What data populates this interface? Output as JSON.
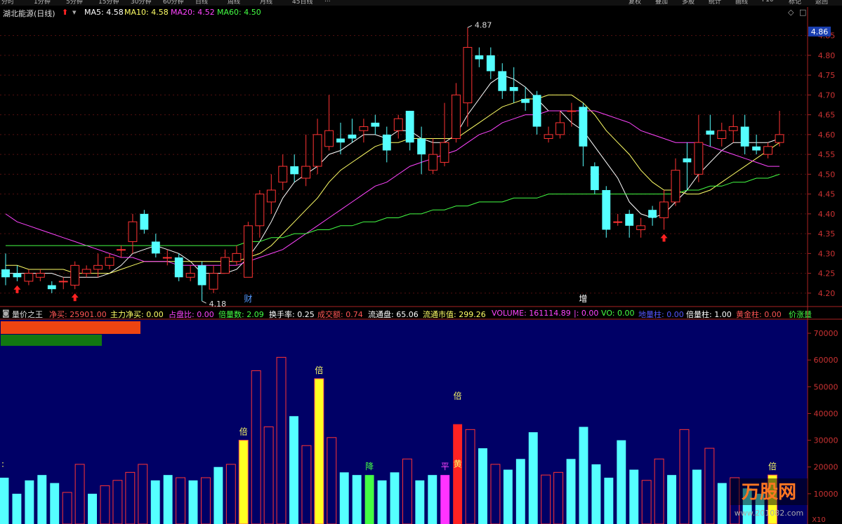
{
  "top_tabs": [
    "分时",
    "1分钟",
    "5分钟",
    "15分钟",
    "30分钟",
    "60分钟",
    "日线",
    "周线",
    "月线",
    "45日线",
    "..."
  ],
  "top_right_buttons": [
    "复权",
    "叠加",
    "多股",
    "统计",
    "画线",
    "F10",
    "标记",
    "返回"
  ],
  "stock": {
    "name": "湖北能源(日线)",
    "ma_labels": [
      {
        "label": "MA5: 4.58",
        "color": "#ffffff"
      },
      {
        "label": "MA10: 4.58",
        "color": "#ffff66"
      },
      {
        "label": "MA20: 4.52",
        "color": "#ff44ff"
      },
      {
        "label": "MA60: 4.50",
        "color": "#44ff44"
      }
    ],
    "current_price_tag": "4.86",
    "high_marker": "4.87",
    "low_marker": "4.18",
    "annotations": [
      "财",
      "增"
    ]
  },
  "volume_panel": {
    "title": "量价之王",
    "indicators": [
      {
        "label": "净买: 25901.00",
        "color": "#ff5555"
      },
      {
        "label": "主力净买: 0.00",
        "color": "#ffff66"
      },
      {
        "label": "占盘比: 0.00",
        "color": "#ff44ff"
      },
      {
        "label": "倍量数: 2.09",
        "color": "#44ff44"
      },
      {
        "label": "换手率: 0.25",
        "color": "#ffffff"
      },
      {
        "label": "成交额: 0.74",
        "color": "#ff5555"
      },
      {
        "label": "流通盘: 65.06",
        "color": "#ffffff"
      },
      {
        "label": "流通市值: 299.26",
        "color": "#ffff66"
      },
      {
        "label": "VOLUME: 161114.89",
        "color": "#ff44ff"
      },
      {
        "label": "|: 0.00",
        "color": "#ff44ff"
      },
      {
        "label": "VO: 0.00",
        "color": "#44ff44"
      },
      {
        "label": "地量柱: 0.00",
        "color": "#5555ff"
      },
      {
        "label": "倍量柱: 1.00",
        "color": "#ffffff"
      },
      {
        "label": "黄金柱: 0.00",
        "color": "#ff5555"
      },
      {
        "label": "价涨量",
        "color": "#44ff44"
      }
    ],
    "markers": [
      "倍",
      "倍",
      "倍",
      "倍",
      "降",
      "平",
      "黄",
      ":"
    ],
    "y_axis_unit": "X10"
  },
  "watermark": {
    "brand": "万股网",
    "site": "www.201082.com"
  },
  "chart_data": [
    {
      "type": "candlestick",
      "ylim": [
        4.18,
        4.87
      ],
      "y_ticks": [
        4.2,
        4.25,
        4.3,
        4.35,
        4.4,
        4.45,
        4.5,
        4.55,
        4.6,
        4.65,
        4.7,
        4.75,
        4.8,
        4.85
      ],
      "candles": [
        [
          4.26,
          4.24,
          4.3,
          4.22
        ],
        [
          4.25,
          4.24,
          4.27,
          4.23
        ],
        [
          4.23,
          4.25,
          4.26,
          4.22
        ],
        [
          4.24,
          4.25,
          4.26,
          4.23
        ],
        [
          4.22,
          4.21,
          4.23,
          4.2
        ],
        [
          4.23,
          4.23,
          4.24,
          4.21
        ],
        [
          4.22,
          4.27,
          4.28,
          4.21
        ],
        [
          4.25,
          4.26,
          4.27,
          4.24
        ],
        [
          4.26,
          4.27,
          4.3,
          4.24
        ],
        [
          4.27,
          4.29,
          4.3,
          4.26
        ],
        [
          4.31,
          4.31,
          4.32,
          4.29
        ],
        [
          4.33,
          4.38,
          4.4,
          4.3
        ],
        [
          4.4,
          4.36,
          4.41,
          4.35
        ],
        [
          4.33,
          4.3,
          4.35,
          4.29
        ],
        [
          4.29,
          4.29,
          4.31,
          4.27
        ],
        [
          4.29,
          4.24,
          4.3,
          4.23
        ],
        [
          4.24,
          4.25,
          4.27,
          4.23
        ],
        [
          4.27,
          4.22,
          4.28,
          4.18
        ],
        [
          4.21,
          4.25,
          4.27,
          4.2
        ],
        [
          4.25,
          4.29,
          4.31,
          4.25
        ],
        [
          4.28,
          4.3,
          4.32,
          4.27
        ],
        [
          4.24,
          4.37,
          4.38,
          4.24
        ],
        [
          4.37,
          4.45,
          4.46,
          4.34
        ],
        [
          4.43,
          4.46,
          4.5,
          4.4
        ],
        [
          4.48,
          4.52,
          4.55,
          4.46
        ],
        [
          4.52,
          4.5,
          4.55,
          4.48
        ],
        [
          4.49,
          4.52,
          4.6,
          4.47
        ],
        [
          4.52,
          4.6,
          4.64,
          4.5
        ],
        [
          4.57,
          4.61,
          4.7,
          4.56
        ],
        [
          4.59,
          4.58,
          4.63,
          4.55
        ],
        [
          4.6,
          4.59,
          4.64,
          4.58
        ],
        [
          4.61,
          4.62,
          4.64,
          4.58
        ],
        [
          4.63,
          4.62,
          4.65,
          4.6
        ],
        [
          4.6,
          4.56,
          4.62,
          4.53
        ],
        [
          4.61,
          4.64,
          4.65,
          4.59
        ],
        [
          4.66,
          4.58,
          4.66,
          4.56
        ],
        [
          4.59,
          4.55,
          4.62,
          4.5
        ],
        [
          4.51,
          4.55,
          4.59,
          4.5
        ],
        [
          4.53,
          4.58,
          4.68,
          4.52
        ],
        [
          4.59,
          4.7,
          4.73,
          4.58
        ],
        [
          4.68,
          4.82,
          4.87,
          4.62
        ],
        [
          4.8,
          4.79,
          4.82,
          4.77
        ],
        [
          4.8,
          4.76,
          4.82,
          4.74
        ],
        [
          4.76,
          4.71,
          4.78,
          4.69
        ],
        [
          4.72,
          4.71,
          4.77,
          4.68
        ],
        [
          4.69,
          4.68,
          4.72,
          4.66
        ],
        [
          4.7,
          4.62,
          4.71,
          4.6
        ],
        [
          4.59,
          4.6,
          4.62,
          4.58
        ],
        [
          4.6,
          4.63,
          4.66,
          4.59
        ],
        [
          4.66,
          4.66,
          4.68,
          4.62
        ],
        [
          4.67,
          4.57,
          4.68,
          4.52
        ],
        [
          4.52,
          4.46,
          4.53,
          4.45
        ],
        [
          4.46,
          4.36,
          4.47,
          4.34
        ],
        [
          4.38,
          4.38,
          4.4,
          4.37
        ],
        [
          4.4,
          4.37,
          4.41,
          4.34
        ],
        [
          4.36,
          4.37,
          4.39,
          4.34
        ],
        [
          4.41,
          4.39,
          4.42,
          4.37
        ],
        [
          4.39,
          4.43,
          4.46,
          4.36
        ],
        [
          4.43,
          4.51,
          4.54,
          4.42
        ],
        [
          4.54,
          4.53,
          4.58,
          4.46
        ],
        [
          4.5,
          4.58,
          4.65,
          4.48
        ],
        [
          4.61,
          4.6,
          4.65,
          4.57
        ],
        [
          4.59,
          4.61,
          4.63,
          4.57
        ],
        [
          4.61,
          4.62,
          4.65,
          4.58
        ],
        [
          4.62,
          4.57,
          4.65,
          4.55
        ],
        [
          4.57,
          4.56,
          4.6,
          4.55
        ],
        [
          4.55,
          4.57,
          4.58,
          4.54
        ],
        [
          4.58,
          4.6,
          4.66,
          4.57
        ]
      ],
      "ma_series": [
        {
          "name": "MA5",
          "color": "#ffffff",
          "values": [
            4.25,
            4.25,
            4.25,
            4.25,
            4.25,
            4.24,
            4.24,
            4.24,
            4.24,
            4.25,
            4.27,
            4.3,
            4.31,
            4.32,
            4.31,
            4.3,
            4.28,
            4.25,
            4.25,
            4.25,
            4.26,
            4.29,
            4.33,
            4.38,
            4.44,
            4.48,
            4.5,
            4.52,
            4.55,
            4.56,
            4.58,
            4.6,
            4.6,
            4.59,
            4.61,
            4.61,
            4.59,
            4.58,
            4.58,
            4.6,
            4.65,
            4.69,
            4.73,
            4.75,
            4.74,
            4.72,
            4.69,
            4.66,
            4.66,
            4.63,
            4.61,
            4.57,
            4.53,
            4.49,
            4.43,
            4.4,
            4.39,
            4.4,
            4.43,
            4.46,
            4.5,
            4.53,
            4.56,
            4.58,
            4.58,
            4.58,
            4.58,
            4.59
          ]
        },
        {
          "name": "MA10",
          "color": "#ffff66",
          "values": [
            4.27,
            4.27,
            4.26,
            4.26,
            4.26,
            4.26,
            4.25,
            4.25,
            4.25,
            4.25,
            4.26,
            4.27,
            4.28,
            4.28,
            4.28,
            4.28,
            4.28,
            4.28,
            4.28,
            4.28,
            4.28,
            4.29,
            4.3,
            4.32,
            4.35,
            4.38,
            4.41,
            4.44,
            4.48,
            4.51,
            4.53,
            4.55,
            4.57,
            4.58,
            4.58,
            4.59,
            4.59,
            4.59,
            4.59,
            4.59,
            4.61,
            4.63,
            4.65,
            4.67,
            4.68,
            4.69,
            4.69,
            4.7,
            4.7,
            4.7,
            4.68,
            4.65,
            4.61,
            4.58,
            4.55,
            4.51,
            4.48,
            4.46,
            4.46,
            4.45,
            4.45,
            4.46,
            4.48,
            4.5,
            4.52,
            4.54,
            4.56,
            4.58
          ]
        },
        {
          "name": "MA20",
          "color": "#ff44ff",
          "values": [
            4.4,
            4.38,
            4.37,
            4.36,
            4.35,
            4.34,
            4.33,
            4.32,
            4.31,
            4.3,
            4.29,
            4.29,
            4.28,
            4.28,
            4.28,
            4.27,
            4.27,
            4.27,
            4.27,
            4.27,
            4.27,
            4.28,
            4.29,
            4.3,
            4.31,
            4.33,
            4.35,
            4.37,
            4.39,
            4.41,
            4.43,
            4.45,
            4.47,
            4.48,
            4.5,
            4.52,
            4.53,
            4.54,
            4.55,
            4.56,
            4.58,
            4.6,
            4.61,
            4.63,
            4.64,
            4.65,
            4.65,
            4.66,
            4.66,
            4.66,
            4.66,
            4.66,
            4.65,
            4.64,
            4.63,
            4.61,
            4.6,
            4.59,
            4.58,
            4.58,
            4.58,
            4.57,
            4.56,
            4.55,
            4.54,
            4.53,
            4.52,
            4.52
          ]
        },
        {
          "name": "MA60",
          "color": "#44ff44",
          "values": [
            4.32,
            4.32,
            4.32,
            4.32,
            4.32,
            4.32,
            4.32,
            4.32,
            4.32,
            4.32,
            4.32,
            4.32,
            4.32,
            4.32,
            4.32,
            4.32,
            4.32,
            4.32,
            4.32,
            4.32,
            4.32,
            4.33,
            4.33,
            4.34,
            4.34,
            4.35,
            4.35,
            4.36,
            4.36,
            4.37,
            4.37,
            4.38,
            4.38,
            4.39,
            4.39,
            4.4,
            4.4,
            4.41,
            4.41,
            4.42,
            4.42,
            4.43,
            4.43,
            4.43,
            4.44,
            4.44,
            4.44,
            4.45,
            4.45,
            4.45,
            4.45,
            4.45,
            4.45,
            4.45,
            4.45,
            4.45,
            4.45,
            4.45,
            4.45,
            4.46,
            4.46,
            4.47,
            4.47,
            4.48,
            4.48,
            4.49,
            4.49,
            4.5
          ]
        }
      ]
    },
    {
      "type": "bar",
      "ylim": [
        0,
        75000
      ],
      "y_ticks": [
        "10000",
        "20000",
        "30000",
        "40000",
        "50000",
        "60000",
        "70000"
      ],
      "bars": [
        {
          "v": 16000,
          "c": "up"
        },
        {
          "v": 10000,
          "c": "up"
        },
        {
          "v": 15000,
          "c": "up"
        },
        {
          "v": 17000,
          "c": "up"
        },
        {
          "v": 14000,
          "c": "up"
        },
        {
          "v": 10500,
          "c": "dn"
        },
        {
          "v": 21000,
          "c": "dn"
        },
        {
          "v": 10000,
          "c": "up"
        },
        {
          "v": 13000,
          "c": "dn"
        },
        {
          "v": 15000,
          "c": "dn"
        },
        {
          "v": 18000,
          "c": "dn"
        },
        {
          "v": 21000,
          "c": "dn"
        },
        {
          "v": 15000,
          "c": "up"
        },
        {
          "v": 17000,
          "c": "up"
        },
        {
          "v": 16000,
          "c": "dn"
        },
        {
          "v": 15000,
          "c": "up"
        },
        {
          "v": 16000,
          "c": "dn"
        },
        {
          "v": 20000,
          "c": "up"
        },
        {
          "v": 21000,
          "c": "dn"
        },
        {
          "v": 30000,
          "c": "yellow"
        },
        {
          "v": 56000,
          "c": "dn"
        },
        {
          "v": 35000,
          "c": "dn"
        },
        {
          "v": 61000,
          "c": "dn"
        },
        {
          "v": 39000,
          "c": "up"
        },
        {
          "v": 28000,
          "c": "dn"
        },
        {
          "v": 53000,
          "c": "yellow"
        },
        {
          "v": 31000,
          "c": "dn"
        },
        {
          "v": 18000,
          "c": "up"
        },
        {
          "v": 17000,
          "c": "up"
        },
        {
          "v": 17000,
          "c": "green"
        },
        {
          "v": 15000,
          "c": "up"
        },
        {
          "v": 18000,
          "c": "up"
        },
        {
          "v": 23000,
          "c": "dn"
        },
        {
          "v": 15000,
          "c": "up"
        },
        {
          "v": 17000,
          "c": "up"
        },
        {
          "v": 17000,
          "c": "magenta"
        },
        {
          "v": 36000,
          "c": "red"
        },
        {
          "v": 34000,
          "c": "dn"
        },
        {
          "v": 27000,
          "c": "up"
        },
        {
          "v": 21000,
          "c": "dn"
        },
        {
          "v": 19000,
          "c": "up"
        },
        {
          "v": 23000,
          "c": "up"
        },
        {
          "v": 33000,
          "c": "up"
        },
        {
          "v": 17000,
          "c": "dn"
        },
        {
          "v": 18000,
          "c": "dn"
        },
        {
          "v": 23000,
          "c": "up"
        },
        {
          "v": 35000,
          "c": "up"
        },
        {
          "v": 21000,
          "c": "up"
        },
        {
          "v": 16000,
          "c": "up"
        },
        {
          "v": 30000,
          "c": "up"
        },
        {
          "v": 19000,
          "c": "up"
        },
        {
          "v": 15000,
          "c": "dn"
        },
        {
          "v": 23000,
          "c": "dn"
        },
        {
          "v": 17000,
          "c": "up"
        },
        {
          "v": 34000,
          "c": "dn"
        },
        {
          "v": 19000,
          "c": "up"
        },
        {
          "v": 27000,
          "c": "dn"
        },
        {
          "v": 14000,
          "c": "up"
        },
        {
          "v": 16000,
          "c": "dn"
        },
        {
          "v": 12000,
          "c": "up"
        },
        {
          "v": 10000,
          "c": "up"
        },
        {
          "v": 17000,
          "c": "yellow"
        }
      ]
    }
  ]
}
